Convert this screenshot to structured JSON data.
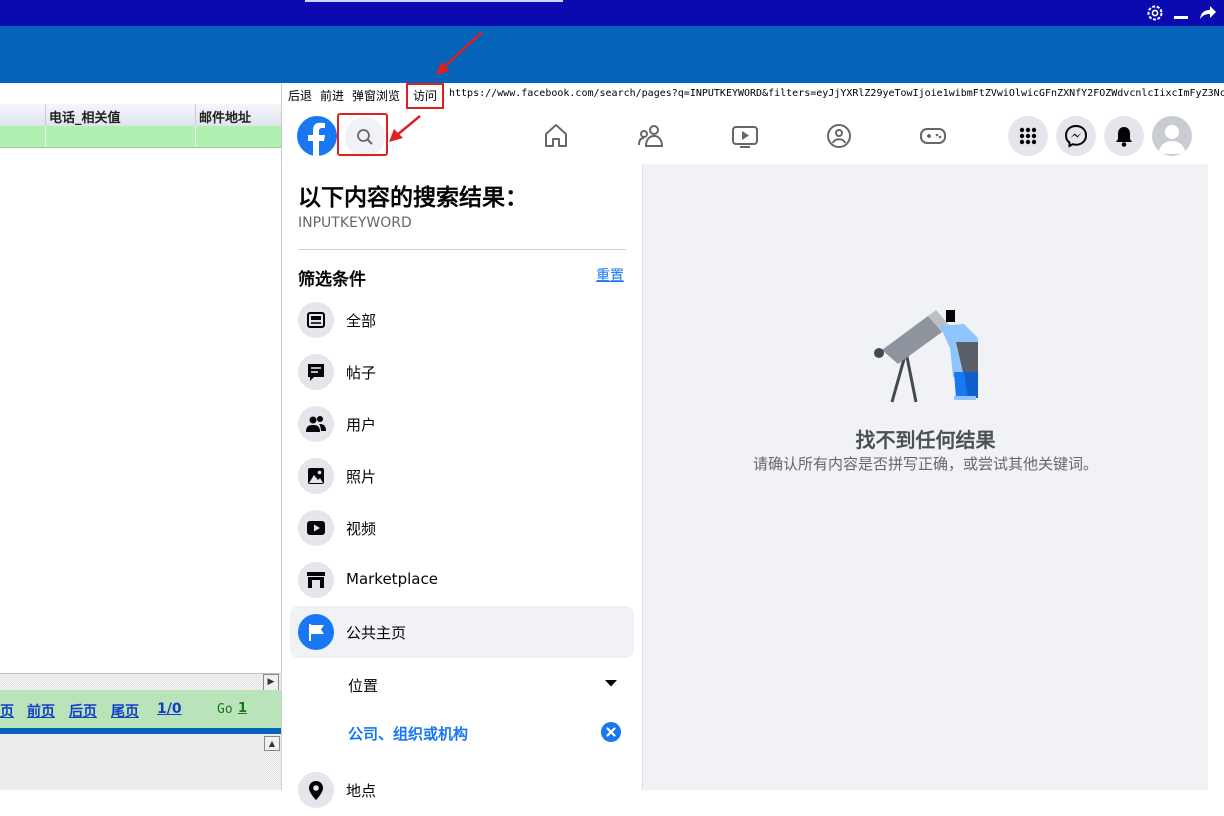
{
  "topbar": {
    "settings_icon": "gear-icon",
    "minimize_icon": "minimize-icon",
    "return_icon": "return-arrow-icon",
    "color": "#0a0ab0"
  },
  "grid": {
    "columns": [
      "电话_相关值",
      "邮件地址"
    ],
    "row_color": "#b2f0b2",
    "pager": {
      "first_partial": "页",
      "prev": "前页",
      "next": "后页",
      "last": "尾页",
      "page_info": "1/0",
      "go_label": "Go",
      "go_page": "1"
    }
  },
  "browser": {
    "back": "后退",
    "forward": "前进",
    "popup_browse": "弹窗浏览",
    "visit": "访问",
    "url": "https://www.facebook.com/search/pages?q=INPUTKEYWORD&filters=eyJjYXRlZ29yeTowIjoie1wibmFtZVwiOlwicGFnZXNfY2FOZWdvcnlcIixcImFyZ3Nc"
  },
  "fb_nav": {
    "logo_icon": "facebook-logo-icon",
    "search_icon": "search-icon",
    "center_icons": [
      "home-icon",
      "friends-icon",
      "watch-icon",
      "groups-icon",
      "gaming-icon"
    ],
    "right_icons": [
      "menu-grid-icon",
      "messenger-icon",
      "notifications-icon",
      "profile-avatar-icon"
    ],
    "brand_color": "#1877f2"
  },
  "search_panel": {
    "title": "以下内容的搜索结果：",
    "keyword": "INPUTKEYWORD",
    "filter_title": "筛选条件",
    "reset": "重置",
    "filters": [
      {
        "label": "全部",
        "icon": "all-results-icon"
      },
      {
        "label": "帖子",
        "icon": "posts-icon"
      },
      {
        "label": "用户",
        "icon": "people-icon"
      },
      {
        "label": "照片",
        "icon": "photos-icon"
      },
      {
        "label": "视频",
        "icon": "videos-icon"
      },
      {
        "label": "Marketplace",
        "icon": "marketplace-icon"
      },
      {
        "label": "公共主页",
        "icon": "pages-flag-icon",
        "active": true
      }
    ],
    "sub_filters": [
      {
        "label": "位置",
        "icon": "dropdown-caret-icon"
      },
      {
        "label": "公司、组织或机构",
        "icon": "clear-filter-icon",
        "selected": true
      }
    ],
    "partial_item": {
      "label": "地点",
      "icon": "places-icon"
    }
  },
  "main": {
    "illustration_icon": "telescope-person-icon",
    "empty_title": "找不到任何结果",
    "empty_subtitle": "请确认所有内容是否拼写正确，或尝试其他关键词。"
  },
  "annotations": {
    "color": "#e02020"
  }
}
